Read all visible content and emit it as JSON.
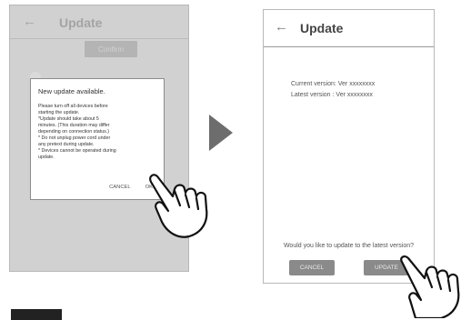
{
  "left_screen": {
    "back_icon": "←",
    "title": "Update",
    "confirm_label": "Confirm",
    "dialog": {
      "title": "New update available.",
      "message_lines": [
        "Please turn off all devices before",
        "starting the update.",
        "*Update should take about 5",
        "minutes. (This duration may differ",
        "depending on connection status.)",
        "* Do not unplug power cord under",
        "any pretext during update.",
        "* Devices cannot be operated during",
        "update."
      ],
      "cancel_label": "CANCEL",
      "ok_label": "OK"
    }
  },
  "right_screen": {
    "back_icon": "←",
    "title": "Update",
    "current_version": "Current version: Ver xxxxxxxx",
    "latest_version": "Latest version   : Ver xxxxxxxx",
    "prompt": "Would you like to update to the latest version?",
    "cancel_label": "CANCEL",
    "update_label": "UPDATE"
  },
  "icons": {
    "back": "arrow-left-icon",
    "step_arrow": "play-triangle-icon",
    "tap_hand": "pointing-hand-icon"
  },
  "colors": {
    "dialog_border": "#8c8c8c",
    "button_gray": "#8a8a8a",
    "arrow_gray": "#6d6d6d"
  }
}
